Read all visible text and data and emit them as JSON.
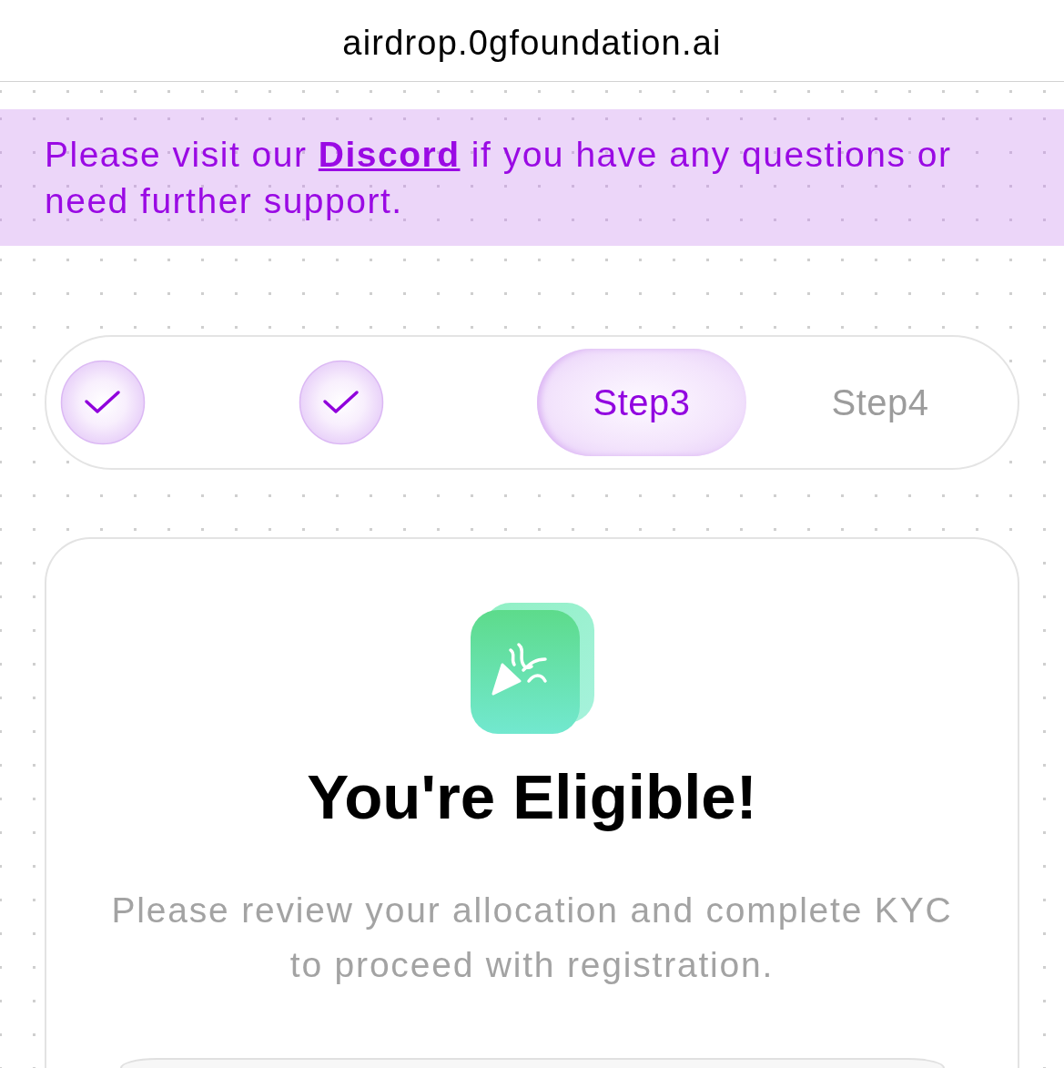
{
  "browser": {
    "url": "airdrop.0gfoundation.ai"
  },
  "notice": {
    "text_before": "Please visit our",
    "link": "Discord",
    "text_after": "if you have any questions or need further support."
  },
  "steps": [
    {
      "completed": true,
      "current": false
    },
    {
      "completed": true,
      "current": false
    },
    {
      "completed": false,
      "current": true,
      "label": "Step3"
    },
    {
      "completed": false,
      "current": false,
      "label": "Step4"
    }
  ],
  "eligibility_card": {
    "title": "You're Eligible!",
    "message": "Please review your allocation and complete KYC to proceed with registration."
  }
}
